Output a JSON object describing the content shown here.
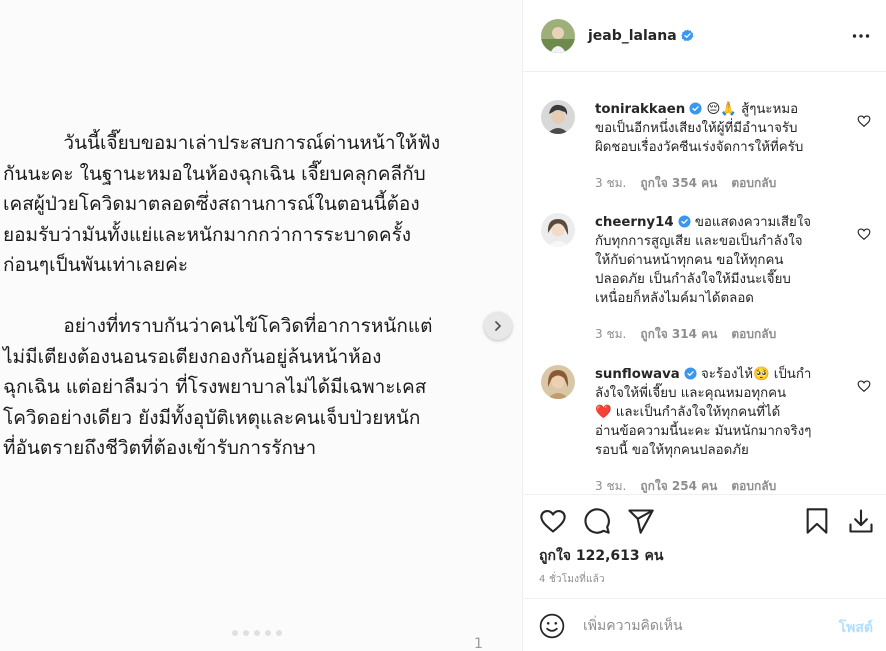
{
  "media": {
    "text": "          วันนี้เจี๊ยบขอมาเล่าประสบการณ์ด่านหน้าให้ฟัง\nกันนะคะ ในฐานะหมอในห้องฉุกเฉิน เจี๊ยบคลุกคลีกับ\nเคสผู้ป่วยโควิดมาตลอดซึ่งสถานการณ์ในตอนนี้ต้อง\nยอมรับว่ามันทั้งแย่และหนักมากกว่าการระบาดครั้ง\nก่อนๆเป็นพันเท่าเลยค่ะ\n\n          อย่างที่ทราบกันว่าคนไข้โควิดที่อาการหนักแต่\nไม่มีเตียงต้องนอนรอเตียงกองกันอยู่ล้นหน้าห้อง\nฉุกเฉิน แต่อย่าลืมว่า ที่โรงพยาบาลไม่ได้มีเฉพาะเคส\nโควิดอย่างเดียว ยังมีทั้งอุบัติเหตุและคนเจ็บป่วยหนัก\nที่อันตรายถึงชีวิตที่ต้องเข้ารับการรักษา",
    "page_number": "1",
    "next_icon": "chevron-right-icon"
  },
  "header": {
    "username": "jeab_lalana",
    "verified": true,
    "more_icon": "more-horizontal-icon"
  },
  "comments": [
    {
      "username": "tonirakkaen",
      "text": "😔🙏 สู้ๆนะหมอ\nขอเป็นอีกหนึ่งเสียงให้ผู้ที่มีอำนาจรับ\nผิดชอบเรื่องวัคซีนเร่งจัดการให้ที่ครับ",
      "time": "3 ชม.",
      "likes": "ถูกใจ 354 คน",
      "reply": "ตอบกลับ"
    },
    {
      "username": "cheerny14",
      "text": "ขอแสดงความเสียใจ\nกับทุกการสูญเสีย และขอเป็นกำลังใจ\nให้กับด่านหน้าทุกคน ขอให้ทุกคน\nปลอดภัย เป็นกำลังใจให้มีงนะเจี๊ยบ\nเหนื่อยก็หลังไมค์มาได้ตลอด",
      "time": "3 ชม.",
      "likes": "ถูกใจ 314 คน",
      "reply": "ตอบกลับ"
    },
    {
      "username": "sunflowava",
      "text": "จะร้องไห้🥺 เป็นกำ\nลังใจให้พี่เจี๊ยบ และคุณหมอทุกคน\n❤️ และเป็นกำลังใจให้ทุกคนที่ได้\nอ่านข้อความนี้นะคะ มันหนักมากจริงๆ\nรอบนี้ ขอให้ทุกคนปลอดภัย",
      "time": "3 ชม.",
      "likes": "ถูกใจ 254 คน",
      "reply": "ตอบกลับ"
    }
  ],
  "actions": {
    "like_icon": "heart-icon",
    "comment_icon": "comment-icon",
    "share_icon": "send-icon",
    "save_icon": "bookmark-icon",
    "download_icon": "download-icon",
    "likes_text": "ถูกใจ 122,613 คน",
    "time_ago": "4 ชั่วโมงที่แล้ว"
  },
  "add_comment": {
    "emoji_icon": "smiley-icon",
    "placeholder": "เพิ่มความคิดเห็น",
    "post_label": "โพสต์"
  },
  "colors": {
    "verified": "#3897f0",
    "post_disabled": "#b2dffc",
    "meta_gray": "#8e8e8e"
  }
}
